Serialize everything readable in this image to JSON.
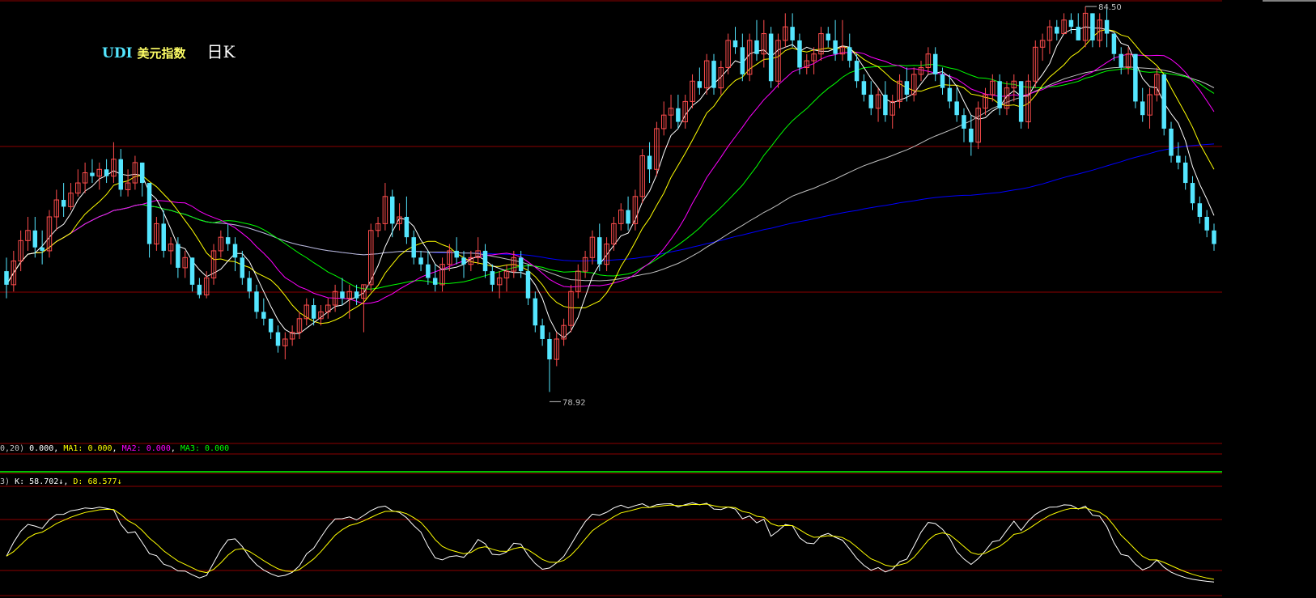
{
  "header": {
    "symbol": "UDI",
    "name": "美元指数",
    "period": "日K"
  },
  "colors": {
    "up": "#ff4d4d",
    "down": "#54e6ff",
    "ma5": "#ffffff",
    "ma10": "#ffff00",
    "ma20": "#ff00ff",
    "ma30": "#00ff00",
    "ma60": "#c0c0c0",
    "ma250": "#0000ff",
    "grid": "#8b0000",
    "kdj_k": "#ffffff",
    "kdj_d": "#ffff00"
  },
  "chart_data": {
    "type": "candlestick",
    "ylim": [
      78.4,
      84.6
    ],
    "annotations": {
      "high": "84.50",
      "low": "78.92"
    },
    "candles": [
      [
        80.7,
        80.9,
        80.3,
        80.5
      ],
      [
        80.5,
        81.0,
        80.4,
        80.85
      ],
      [
        80.85,
        81.3,
        80.7,
        81.15
      ],
      [
        81.15,
        81.5,
        81.0,
        81.3
      ],
      [
        81.3,
        81.5,
        80.9,
        81.05
      ],
      [
        81.05,
        81.3,
        80.8,
        81.0
      ],
      [
        81.0,
        81.6,
        80.9,
        81.5
      ],
      [
        81.5,
        81.9,
        81.3,
        81.75
      ],
      [
        81.75,
        82.0,
        81.5,
        81.65
      ],
      [
        81.65,
        82.0,
        81.6,
        81.85
      ],
      [
        81.85,
        82.2,
        81.8,
        82.0
      ],
      [
        82.0,
        82.3,
        81.85,
        82.15
      ],
      [
        82.15,
        82.35,
        82.0,
        82.1
      ],
      [
        82.1,
        82.3,
        81.9,
        82.2
      ],
      [
        82.2,
        82.35,
        82.0,
        82.1
      ],
      [
        82.1,
        82.6,
        82.0,
        82.35
      ],
      [
        82.35,
        82.5,
        81.8,
        81.9
      ],
      [
        81.9,
        82.2,
        81.8,
        82.0
      ],
      [
        82.0,
        82.4,
        81.9,
        82.3
      ],
      [
        82.3,
        82.3,
        81.8,
        82.0
      ],
      [
        82.0,
        82.0,
        80.9,
        81.1
      ],
      [
        81.1,
        81.5,
        81.0,
        81.4
      ],
      [
        81.4,
        81.6,
        80.9,
        81.0
      ],
      [
        81.0,
        81.2,
        80.8,
        81.1
      ],
      [
        81.1,
        81.2,
        80.6,
        80.75
      ],
      [
        80.75,
        81.0,
        80.6,
        80.9
      ],
      [
        80.9,
        80.9,
        80.4,
        80.5
      ],
      [
        80.5,
        80.6,
        80.3,
        80.35
      ],
      [
        80.35,
        80.7,
        80.3,
        80.6
      ],
      [
        80.6,
        81.1,
        80.5,
        81.0
      ],
      [
        81.0,
        81.3,
        80.9,
        81.2
      ],
      [
        81.2,
        81.4,
        81.0,
        81.1
      ],
      [
        81.1,
        81.2,
        80.7,
        80.9
      ],
      [
        80.9,
        81.0,
        80.5,
        80.6
      ],
      [
        80.6,
        80.7,
        80.3,
        80.4
      ],
      [
        80.4,
        80.5,
        80.0,
        80.1
      ],
      [
        80.1,
        80.3,
        79.9,
        80.0
      ],
      [
        80.0,
        80.0,
        79.7,
        79.8
      ],
      [
        79.8,
        79.9,
        79.5,
        79.6
      ],
      [
        79.6,
        79.8,
        79.4,
        79.7
      ],
      [
        79.7,
        79.9,
        79.6,
        79.8
      ],
      [
        79.8,
        80.1,
        79.7,
        80.0
      ],
      [
        80.0,
        80.3,
        79.9,
        80.2
      ],
      [
        80.2,
        80.3,
        79.9,
        80.0
      ],
      [
        80.0,
        80.2,
        79.9,
        80.1
      ],
      [
        80.1,
        80.3,
        80.0,
        80.2
      ],
      [
        80.2,
        80.5,
        80.1,
        80.4
      ],
      [
        80.4,
        80.6,
        80.2,
        80.3
      ],
      [
        80.3,
        80.5,
        80.0,
        80.4
      ],
      [
        80.4,
        80.5,
        80.2,
        80.3
      ],
      [
        80.3,
        80.5,
        79.8,
        80.5
      ],
      [
        80.5,
        81.4,
        80.4,
        81.3
      ],
      [
        81.3,
        81.5,
        81.2,
        81.4
      ],
      [
        81.4,
        82.0,
        81.3,
        81.8
      ],
      [
        81.8,
        81.9,
        81.2,
        81.4
      ],
      [
        81.4,
        81.7,
        81.3,
        81.5
      ],
      [
        81.5,
        81.8,
        81.1,
        81.2
      ],
      [
        81.2,
        81.3,
        80.8,
        80.9
      ],
      [
        80.9,
        81.0,
        80.7,
        80.8
      ],
      [
        80.8,
        81.0,
        80.5,
        80.6
      ],
      [
        80.6,
        80.8,
        80.4,
        80.5
      ],
      [
        80.5,
        80.9,
        80.4,
        80.8
      ],
      [
        80.8,
        81.1,
        80.7,
        81.0
      ],
      [
        81.0,
        81.2,
        80.8,
        80.9
      ],
      [
        80.9,
        81.0,
        80.6,
        80.8
      ],
      [
        80.8,
        81.0,
        80.7,
        80.9
      ],
      [
        80.9,
        81.2,
        80.8,
        81.0
      ],
      [
        81.0,
        81.1,
        80.6,
        80.7
      ],
      [
        80.7,
        80.8,
        80.4,
        80.5
      ],
      [
        80.5,
        80.7,
        80.3,
        80.6
      ],
      [
        80.6,
        80.8,
        80.4,
        80.7
      ],
      [
        80.7,
        81.0,
        80.6,
        80.9
      ],
      [
        80.9,
        81.0,
        80.6,
        80.7
      ],
      [
        80.7,
        80.8,
        80.2,
        80.3
      ],
      [
        80.3,
        80.4,
        79.8,
        79.9
      ],
      [
        79.9,
        80.0,
        79.6,
        79.7
      ],
      [
        79.7,
        79.8,
        78.92,
        79.4
      ],
      [
        79.4,
        79.8,
        79.3,
        79.7
      ],
      [
        79.7,
        80.0,
        79.6,
        79.9
      ],
      [
        79.9,
        80.5,
        79.8,
        80.4
      ],
      [
        80.4,
        80.8,
        80.3,
        80.7
      ],
      [
        80.7,
        81.0,
        80.6,
        80.9
      ],
      [
        80.9,
        81.3,
        80.8,
        81.2
      ],
      [
        81.2,
        81.4,
        80.7,
        80.8
      ],
      [
        80.8,
        81.2,
        80.7,
        81.1
      ],
      [
        81.1,
        81.5,
        81.0,
        81.4
      ],
      [
        81.4,
        81.7,
        81.3,
        81.6
      ],
      [
        81.6,
        81.8,
        81.3,
        81.4
      ],
      [
        81.4,
        81.9,
        81.3,
        81.8
      ],
      [
        81.8,
        82.5,
        81.7,
        82.4
      ],
      [
        82.4,
        82.6,
        82.0,
        82.2
      ],
      [
        82.2,
        82.9,
        82.1,
        82.8
      ],
      [
        82.8,
        83.2,
        82.7,
        83.0
      ],
      [
        83.0,
        83.3,
        82.8,
        83.1
      ],
      [
        83.1,
        83.3,
        82.8,
        82.9
      ],
      [
        82.9,
        83.3,
        82.8,
        83.2
      ],
      [
        83.2,
        83.6,
        83.1,
        83.5
      ],
      [
        83.5,
        83.7,
        83.3,
        83.4
      ],
      [
        83.4,
        83.9,
        83.3,
        83.8
      ],
      [
        83.8,
        83.9,
        83.3,
        83.4
      ],
      [
        83.4,
        83.8,
        83.3,
        83.7
      ],
      [
        83.7,
        84.2,
        83.6,
        84.1
      ],
      [
        84.1,
        84.3,
        83.9,
        84.0
      ],
      [
        84.0,
        84.2,
        83.5,
        83.6
      ],
      [
        83.6,
        84.2,
        83.5,
        84.1
      ],
      [
        84.1,
        84.4,
        83.8,
        83.9
      ],
      [
        83.9,
        84.4,
        83.7,
        84.2
      ],
      [
        84.2,
        84.3,
        83.4,
        83.5
      ],
      [
        83.5,
        84.2,
        83.4,
        84.1
      ],
      [
        84.1,
        84.5,
        84.0,
        84.3
      ],
      [
        84.3,
        84.5,
        84.0,
        84.1
      ],
      [
        84.1,
        84.2,
        83.6,
        83.7
      ],
      [
        83.7,
        83.9,
        83.6,
        83.8
      ],
      [
        83.8,
        84.0,
        83.6,
        83.9
      ],
      [
        83.9,
        84.3,
        83.8,
        84.2
      ],
      [
        84.2,
        84.3,
        84.0,
        84.1
      ],
      [
        84.1,
        84.4,
        83.8,
        83.9
      ],
      [
        83.9,
        84.4,
        83.8,
        84.0
      ],
      [
        84.0,
        84.2,
        83.7,
        83.8
      ],
      [
        83.8,
        83.9,
        83.4,
        83.5
      ],
      [
        83.5,
        83.6,
        83.2,
        83.3
      ],
      [
        83.3,
        83.5,
        83.0,
        83.1
      ],
      [
        83.1,
        83.4,
        82.9,
        83.3
      ],
      [
        83.3,
        83.5,
        82.9,
        83.0
      ],
      [
        83.0,
        83.3,
        82.8,
        83.2
      ],
      [
        83.2,
        83.6,
        83.1,
        83.5
      ],
      [
        83.5,
        83.7,
        83.2,
        83.3
      ],
      [
        83.3,
        83.7,
        83.2,
        83.6
      ],
      [
        83.6,
        83.8,
        83.5,
        83.7
      ],
      [
        83.7,
        84.0,
        83.6,
        83.9
      ],
      [
        83.9,
        84.0,
        83.5,
        83.6
      ],
      [
        83.6,
        83.7,
        83.3,
        83.4
      ],
      [
        83.4,
        83.6,
        83.1,
        83.2
      ],
      [
        83.2,
        83.4,
        82.9,
        83.0
      ],
      [
        83.0,
        83.1,
        82.6,
        82.8
      ],
      [
        82.8,
        83.0,
        82.4,
        82.6
      ],
      [
        82.6,
        83.2,
        82.5,
        83.1
      ],
      [
        83.1,
        83.4,
        83.0,
        83.3
      ],
      [
        83.3,
        83.6,
        83.2,
        83.5
      ],
      [
        83.5,
        83.6,
        83.0,
        83.1
      ],
      [
        83.1,
        83.5,
        83.0,
        83.4
      ],
      [
        83.4,
        83.6,
        83.2,
        83.5
      ],
      [
        83.5,
        83.5,
        82.8,
        82.9
      ],
      [
        82.9,
        83.6,
        82.8,
        83.5
      ],
      [
        83.5,
        84.1,
        83.4,
        84.0
      ],
      [
        84.0,
        84.2,
        83.8,
        84.1
      ],
      [
        84.1,
        84.4,
        83.9,
        84.3
      ],
      [
        84.3,
        84.4,
        84.1,
        84.2
      ],
      [
        84.2,
        84.5,
        84.2,
        84.4
      ],
      [
        84.4,
        84.5,
        84.2,
        84.3
      ],
      [
        84.3,
        84.5,
        84.1,
        84.1
      ],
      [
        84.1,
        84.6,
        84.0,
        84.5
      ],
      [
        84.5,
        84.5,
        84.0,
        84.1
      ],
      [
        84.1,
        84.5,
        84.0,
        84.4
      ],
      [
        84.4,
        84.6,
        84.0,
        84.2
      ],
      [
        84.2,
        84.2,
        83.8,
        83.9
      ],
      [
        83.9,
        84.0,
        83.6,
        83.7
      ],
      [
        83.7,
        84.0,
        83.6,
        83.9
      ],
      [
        83.9,
        83.9,
        83.1,
        83.2
      ],
      [
        83.2,
        83.4,
        82.9,
        83.0
      ],
      [
        83.0,
        83.4,
        82.8,
        83.3
      ],
      [
        83.3,
        83.7,
        83.2,
        83.6
      ],
      [
        83.6,
        83.6,
        82.7,
        82.8
      ],
      [
        82.8,
        82.9,
        82.3,
        82.4
      ],
      [
        82.4,
        82.6,
        82.2,
        82.3
      ],
      [
        82.3,
        82.4,
        81.9,
        82.0
      ],
      [
        82.0,
        82.1,
        81.6,
        81.7
      ],
      [
        81.7,
        81.8,
        81.4,
        81.5
      ],
      [
        81.5,
        81.6,
        81.2,
        81.3
      ],
      [
        81.3,
        81.4,
        81.0,
        81.1
      ]
    ],
    "indicators": {
      "macd": {
        "label_prefix": "0,20)",
        "value": "0.000",
        "ma1_label": "MA1:",
        "ma1_value": "0.000",
        "ma2_label": "MA2:",
        "ma2_value": "0.000",
        "ma3_label": "MA3:",
        "ma3_value": "0.000"
      },
      "kdj": {
        "label_prefix": "3)",
        "k_label": "K:",
        "k_value": "58.702",
        "d_label": "D:",
        "d_value": "68.577",
        "arrow": "↓"
      }
    }
  }
}
